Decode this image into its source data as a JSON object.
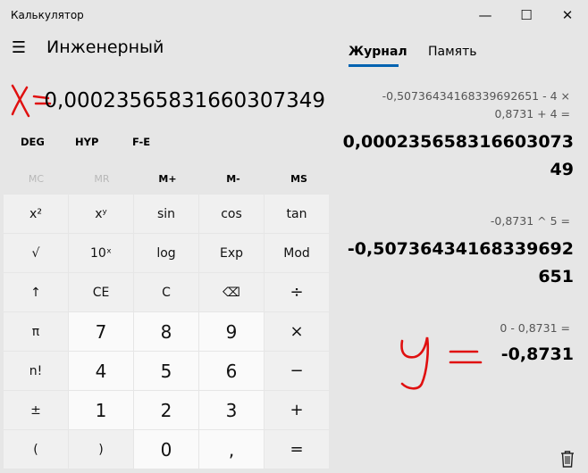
{
  "window": {
    "title": "Калькулятор",
    "minimize_glyph": "—",
    "maximize_glyph": "☐",
    "close_glyph": "✕"
  },
  "header": {
    "menu_glyph": "☰",
    "mode_title": "Инженерный"
  },
  "display": {
    "value": "0,00023565831660307349"
  },
  "annotations": {
    "x_mark_icon": "handwritten-x-equals-icon",
    "y_mark_icon": "handwritten-y-equals-icon",
    "color": "#e01010"
  },
  "mode_buttons": [
    "DEG",
    "HYP",
    "F-E"
  ],
  "memory_buttons": [
    {
      "label": "MC",
      "enabled": false
    },
    {
      "label": "MR",
      "enabled": false
    },
    {
      "label": "M+",
      "enabled": true
    },
    {
      "label": "M-",
      "enabled": true
    },
    {
      "label": "MS",
      "enabled": true
    }
  ],
  "keys": [
    {
      "label": "x²",
      "name": "x-squared-key"
    },
    {
      "label": "xʸ",
      "name": "x-power-y-key"
    },
    {
      "label": "sin",
      "name": "sin-key"
    },
    {
      "label": "cos",
      "name": "cos-key"
    },
    {
      "label": "tan",
      "name": "tan-key"
    },
    {
      "label": "√",
      "name": "sqrt-key"
    },
    {
      "label": "10ˣ",
      "name": "ten-power-x-key"
    },
    {
      "label": "log",
      "name": "log-key"
    },
    {
      "label": "Exp",
      "name": "exp-key"
    },
    {
      "label": "Mod",
      "name": "mod-key"
    },
    {
      "label": "↑",
      "name": "shift-key"
    },
    {
      "label": "CE",
      "name": "clear-entry-key"
    },
    {
      "label": "C",
      "name": "clear-key"
    },
    {
      "label": "⌫",
      "name": "backspace-key"
    },
    {
      "label": "÷",
      "name": "divide-key"
    },
    {
      "label": "π",
      "name": "pi-key"
    },
    {
      "label": "7",
      "name": "digit-7-key",
      "num": true
    },
    {
      "label": "8",
      "name": "digit-8-key",
      "num": true
    },
    {
      "label": "9",
      "name": "digit-9-key",
      "num": true
    },
    {
      "label": "×",
      "name": "multiply-key"
    },
    {
      "label": "n!",
      "name": "factorial-key"
    },
    {
      "label": "4",
      "name": "digit-4-key",
      "num": true
    },
    {
      "label": "5",
      "name": "digit-5-key",
      "num": true
    },
    {
      "label": "6",
      "name": "digit-6-key",
      "num": true
    },
    {
      "label": "−",
      "name": "minus-key"
    },
    {
      "label": "±",
      "name": "negate-key"
    },
    {
      "label": "1",
      "name": "digit-1-key",
      "num": true
    },
    {
      "label": "2",
      "name": "digit-2-key",
      "num": true
    },
    {
      "label": "3",
      "name": "digit-3-key",
      "num": true
    },
    {
      "label": "+",
      "name": "plus-key"
    },
    {
      "label": "(",
      "name": "open-paren-key"
    },
    {
      "label": ")",
      "name": "close-paren-key"
    },
    {
      "label": "0",
      "name": "digit-0-key",
      "num": true
    },
    {
      "label": ",",
      "name": "decimal-key",
      "num": true
    },
    {
      "label": "=",
      "name": "equals-key"
    }
  ],
  "history_panel": {
    "tabs": [
      "Журнал",
      "Память"
    ],
    "entries": [
      {
        "expr_line1": "-0,50736434168339692651   -   4   ×",
        "expr_line2": "0,8731   +   4 =",
        "result_line1": "0,000235658316603073",
        "result_line2": "49"
      },
      {
        "expr_line1": "-0,8731   ^   5 =",
        "result_line1": "-0,50736434168339692",
        "result_line2": "651"
      },
      {
        "expr_line1": "0   -   0,8731 =",
        "result_line1": "-0,8731"
      }
    ],
    "trash_icon": "trash-icon"
  }
}
